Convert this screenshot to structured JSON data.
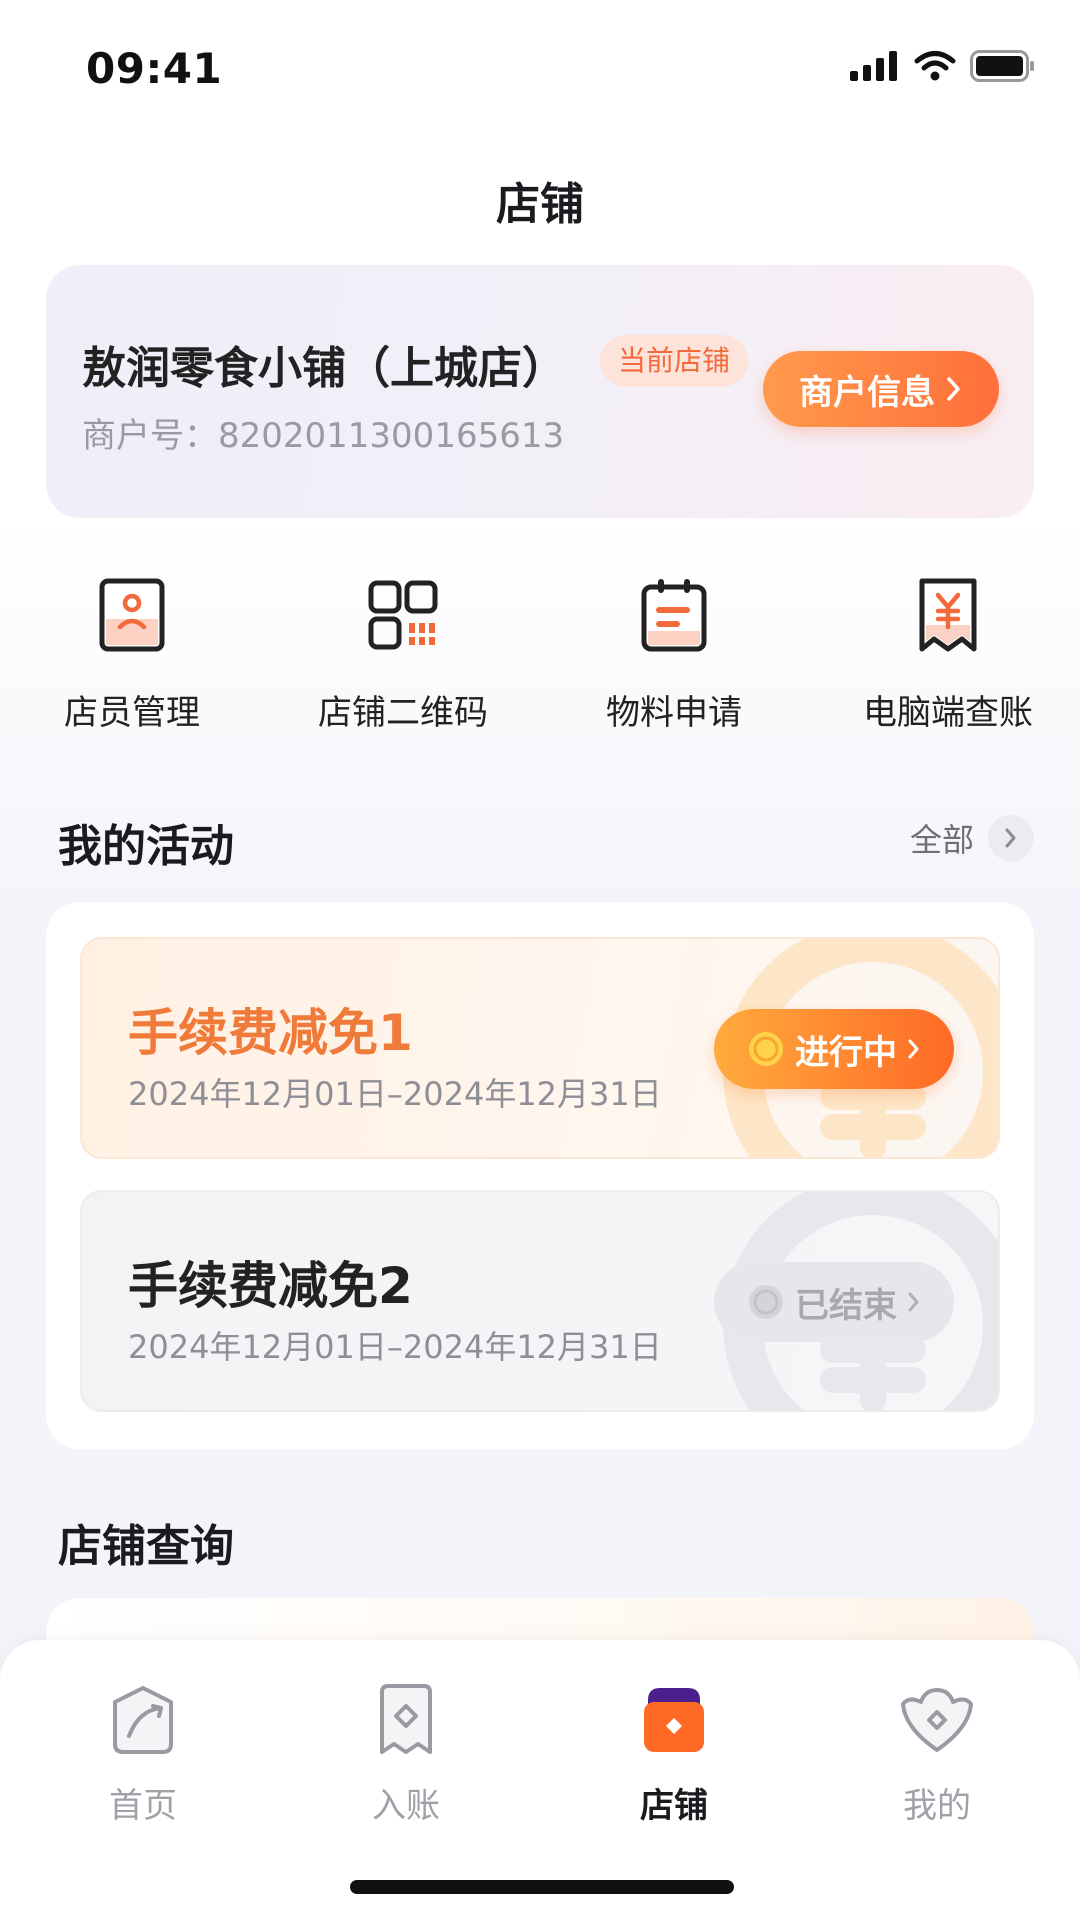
{
  "status_bar": {
    "time": "09:41",
    "icons": [
      "signal-icon",
      "wifi-icon",
      "battery-icon"
    ]
  },
  "header": {
    "title": "店铺"
  },
  "store": {
    "name": "敖润零食小铺（上城店）",
    "badge": "当前店铺",
    "merchant_no": "商户号：8202011300165613",
    "info_button": "商户信息"
  },
  "quick_actions": [
    {
      "label": "店员管理",
      "icon": "staff-icon"
    },
    {
      "label": "店铺二维码",
      "icon": "qr-code-icon"
    },
    {
      "label": "物料申请",
      "icon": "material-icon"
    },
    {
      "label": "电脑端查账",
      "icon": "bill-icon"
    }
  ],
  "activities": {
    "title": "我的活动",
    "all_link": "全部",
    "items": [
      {
        "title": "手续费减免1",
        "date": "2024年12月01日–2024年12月31日",
        "status": "进行中"
      },
      {
        "title": "手续费减免2",
        "date": "2024年12月01日–2024年12月31日",
        "status": "已结束"
      }
    ]
  },
  "query": {
    "title": "店铺查询"
  },
  "tabbar": {
    "items": [
      {
        "label": "首页",
        "icon": "home-icon"
      },
      {
        "label": "入账",
        "icon": "receipt-icon"
      },
      {
        "label": "店铺",
        "icon": "store-icon",
        "active": true
      },
      {
        "label": "我的",
        "icon": "profile-icon"
      }
    ]
  },
  "colors": {
    "accent": "#ff6f3a",
    "active_tab": "#1a1a1f",
    "inactive_tab": "#a0a0a8"
  }
}
